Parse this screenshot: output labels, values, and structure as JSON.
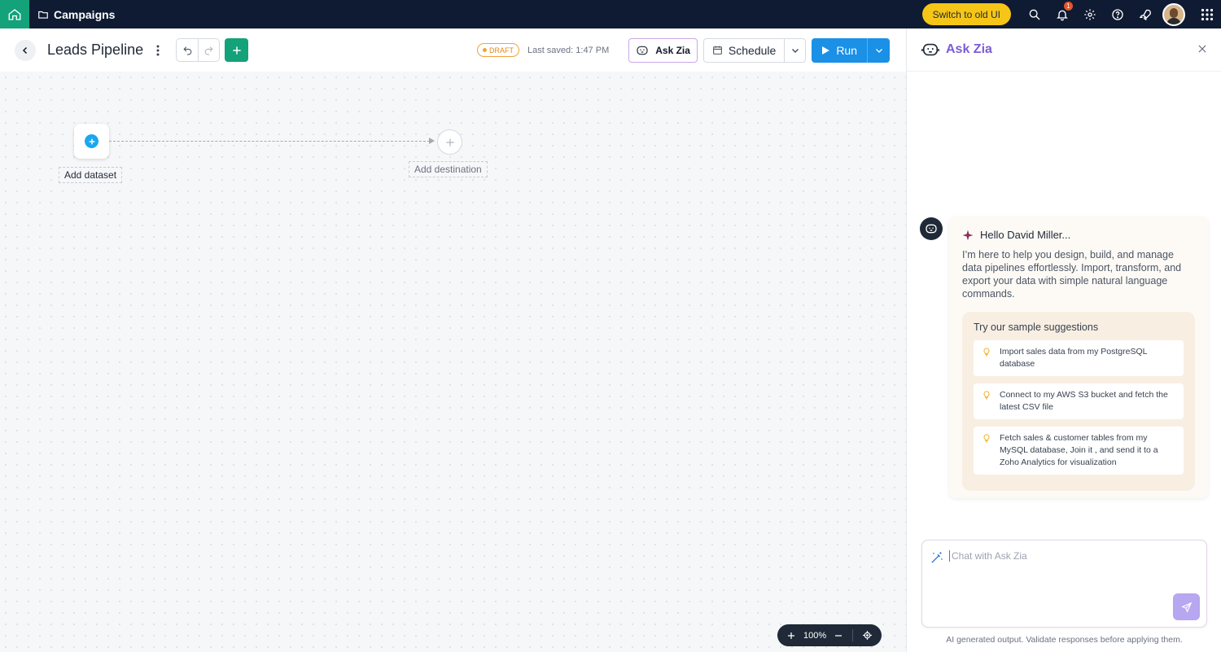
{
  "topnav": {
    "breadcrumb": "Campaigns",
    "switch_label": "Switch to old UI",
    "notification_count": "1"
  },
  "toolbar": {
    "title": "Leads Pipeline",
    "draft_label": "DRAFT",
    "last_saved": "Last saved: 1:47 PM",
    "ask_zia_label": "Ask Zia",
    "schedule_label": "Schedule",
    "run_label": "Run"
  },
  "canvas": {
    "add_dataset_label": "Add dataset",
    "add_destination_label": "Add destination",
    "zoom_level": "100%"
  },
  "zia_panel": {
    "title": "Ask Zia",
    "greeting": "Hello David Miller...",
    "intro": "I’m here to help you design, build, and manage data pipelines effortlessly. Import, transform, and export your data with simple natural language commands.",
    "suggestions_title": "Try our sample suggestions",
    "suggestions": [
      "Import sales data from my PostgreSQL database",
      "Connect to my AWS S3 bucket and fetch the latest CSV file",
      "Fetch sales & customer tables from my MySQL database, Join it , and send it to a Zoho Analytics for visualization"
    ],
    "chat_placeholder": "Chat with Ask Zia",
    "disclaimer": "AI generated output. Validate responses before applying them."
  },
  "colors": {
    "nav_bg": "#0f1b33",
    "brand_green": "#13a27a",
    "run_blue": "#1a90e6",
    "zia_purple": "#7c5cd6",
    "switch_yellow": "#f5c518"
  }
}
